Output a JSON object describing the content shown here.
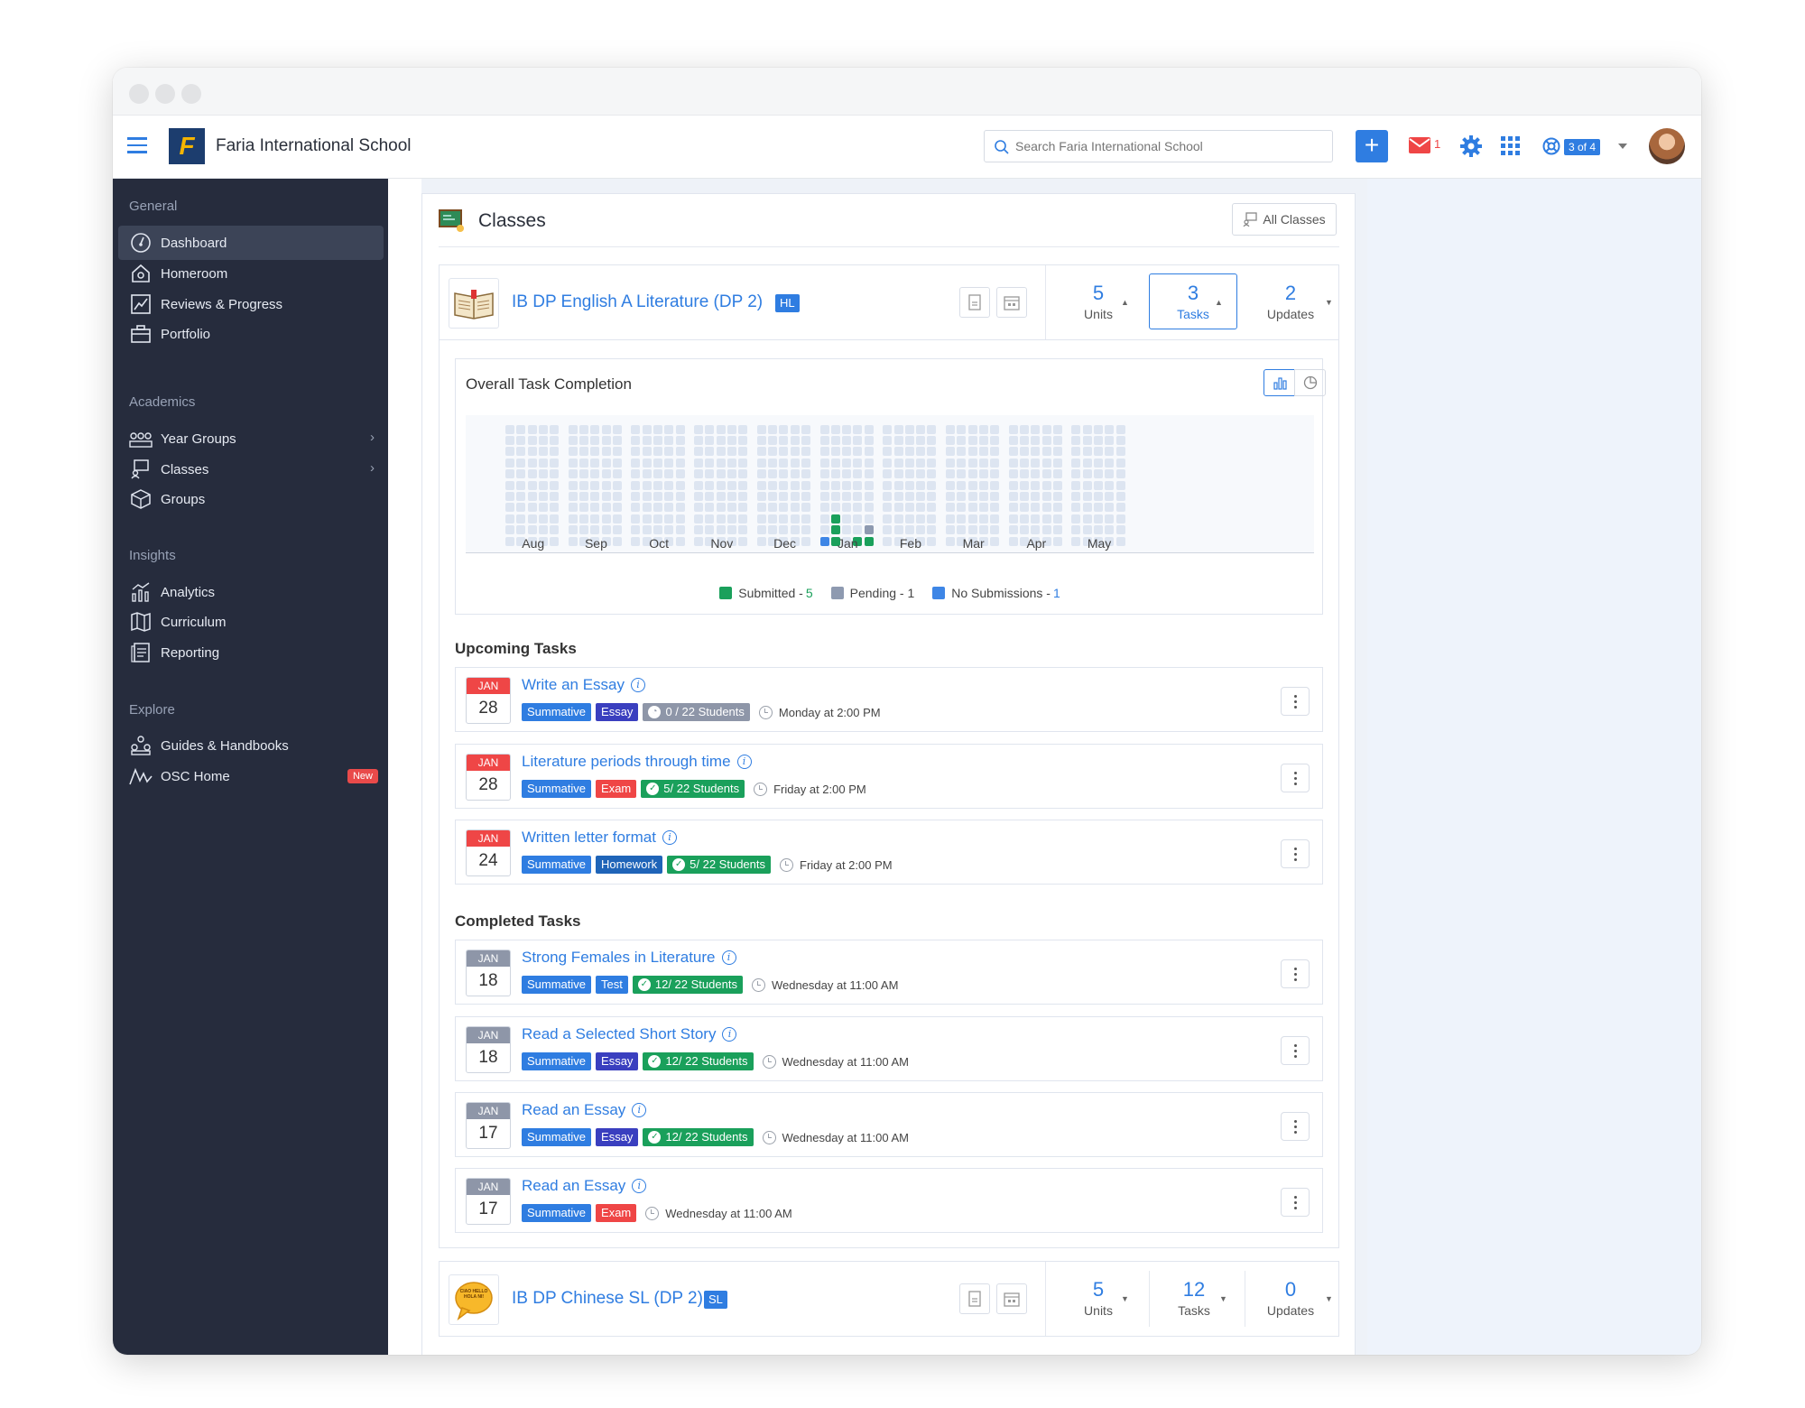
{
  "app": {
    "school_name": "Faria International School",
    "search_placeholder": "Search Faria International School",
    "mail_count": "1",
    "help_badge": "3 of 4",
    "colors": {
      "accent": "#2f7de1",
      "sidebar": "#262c3d",
      "red": "#ef4646",
      "green": "#1aa05b"
    }
  },
  "sidebar": {
    "sections": {
      "general": "General",
      "academics": "Academics",
      "insights": "Insights",
      "explore": "Explore"
    },
    "items": [
      {
        "label": "Dashboard",
        "icon": "dashboard-icon"
      },
      {
        "label": "Homeroom",
        "icon": "homeroom-icon"
      },
      {
        "label": "Reviews & Progress",
        "icon": "chart-line-icon"
      },
      {
        "label": "Portfolio",
        "icon": "briefcase-icon"
      },
      {
        "label": "Year Groups",
        "icon": "year-groups-icon"
      },
      {
        "label": "Classes",
        "icon": "classes-icon"
      },
      {
        "label": "Groups",
        "icon": "cube-icon"
      },
      {
        "label": "Analytics",
        "icon": "analytics-icon"
      },
      {
        "label": "Curriculum",
        "icon": "map-icon"
      },
      {
        "label": "Reporting",
        "icon": "report-icon"
      },
      {
        "label": "Guides & Handbooks",
        "icon": "guides-icon"
      },
      {
        "label": "OSC Home",
        "icon": "osc-icon"
      }
    ],
    "new_badge": "New"
  },
  "classes_panel": {
    "title": "Classes",
    "all_classes_label": "All Classes"
  },
  "class1": {
    "name": "IB DP English A Literature (DP 2)",
    "level": "HL",
    "units_num": "5",
    "units_label": "Units",
    "tasks_num": "3",
    "tasks_label": "Tasks",
    "updates_num": "2",
    "updates_label": "Updates"
  },
  "completion": {
    "title": "Overall Task Completion",
    "legend": {
      "submitted_label": "Submitted - ",
      "submitted_count": "5",
      "pending_label": "Pending - 1",
      "nosub_label": "No Submissions - ",
      "nosub_count": "1"
    }
  },
  "chart_data": {
    "type": "heatmap",
    "categories": [
      "Aug",
      "Sep",
      "Oct",
      "Nov",
      "Dec",
      "Jan",
      "Feb",
      "Mar",
      "Apr",
      "May"
    ],
    "columns_per_category": 5,
    "rows": 11,
    "series": [
      {
        "name": "Submitted",
        "count": 5,
        "color": "#1aa05b",
        "cells": [
          [
            26,
            3
          ],
          [
            26,
            2
          ],
          [
            26,
            1
          ],
          [
            28,
            1
          ],
          [
            29,
            1
          ]
        ]
      },
      {
        "name": "Pending",
        "count": 1,
        "color": "#8e9ab0",
        "cells": [
          [
            29,
            2
          ]
        ]
      },
      {
        "name": "No Submissions",
        "count": 1,
        "color": "#3e86e6",
        "cells": [
          [
            25,
            1
          ]
        ]
      }
    ],
    "empty_color": "#dde5f1"
  },
  "upcoming": {
    "heading": "Upcoming Tasks",
    "tasks": [
      {
        "month": "JAN",
        "day": "28",
        "title": "Write an Essay",
        "type": "Summative",
        "kind": "Essay",
        "status": "0 / 22 Students",
        "due": "Monday at 2:00 PM"
      },
      {
        "month": "JAN",
        "day": "28",
        "title": "Literature periods through time",
        "type": "Summative",
        "kind": "Exam",
        "status": "5/ 22 Students",
        "due": "Friday at 2:00 PM"
      },
      {
        "month": "JAN",
        "day": "24",
        "title": "Written letter format",
        "type": "Summative",
        "kind": "Homework",
        "status": "5/ 22 Students",
        "due": "Friday at 2:00 PM"
      }
    ]
  },
  "completed": {
    "heading": "Completed Tasks",
    "tasks": [
      {
        "month": "JAN",
        "day": "18",
        "title": "Strong Females in Literature",
        "type": "Summative",
        "kind": "Test",
        "status": "12/ 22 Students",
        "due": "Wednesday at 11:00 AM"
      },
      {
        "month": "JAN",
        "day": "18",
        "title": "Read a Selected Short Story",
        "type": "Summative",
        "kind": "Essay",
        "status": "12/ 22 Students",
        "due": "Wednesday at 11:00 AM"
      },
      {
        "month": "JAN",
        "day": "17",
        "title": "Read an Essay",
        "type": "Summative",
        "kind": "Essay",
        "status": "12/ 22 Students",
        "due": "Wednesday at 11:00 AM"
      },
      {
        "month": "JAN",
        "day": "17",
        "title": "Read an Essay",
        "type": "Summative",
        "kind": "Exam",
        "due": "Wednesday at 11:00 AM"
      }
    ]
  },
  "class2": {
    "name": "IB DP Chinese SL (DP 2)",
    "level": "SL",
    "units_num": "5",
    "units_label": "Units",
    "tasks_num": "12",
    "tasks_label": "Tasks",
    "updates_num": "0",
    "updates_label": "Updates",
    "logo_text": "CIAO HELLO HOLA NI!"
  }
}
